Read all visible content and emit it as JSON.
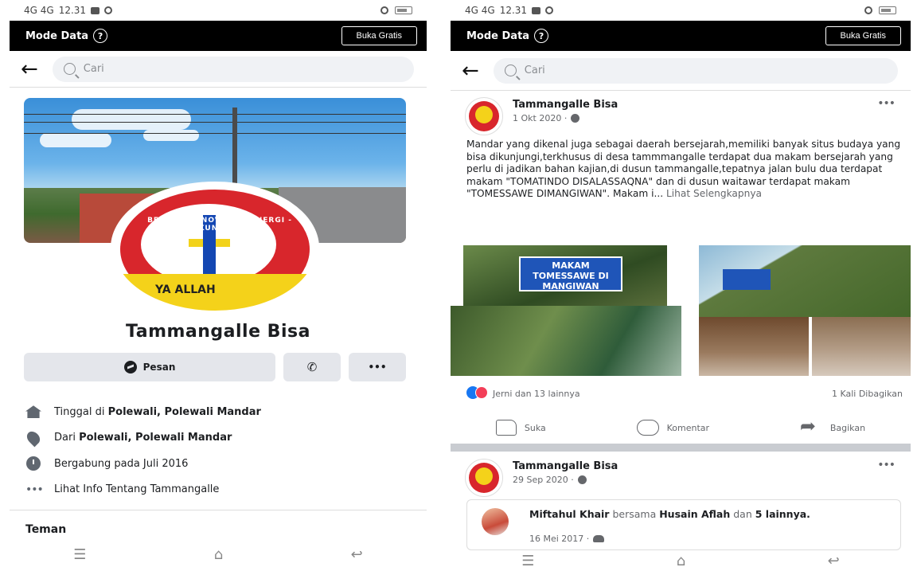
{
  "status": {
    "signal": "4G 4G",
    "time": "12.31"
  },
  "mode_bar": {
    "label": "Mode Data",
    "help_icon": "?",
    "free_button": "Buka Gratis"
  },
  "search": {
    "placeholder": "Cari"
  },
  "profile": {
    "name": "Tammangalle Bisa",
    "actions": {
      "message": "Pesan",
      "more": "•••"
    },
    "logo_ring_text": "BEKERJA - INOVASI - SINERGI - AKUNTABEL",
    "logo_banner_text": "YA ALLAH",
    "info": [
      {
        "prefix": "Tinggal di ",
        "bold": "Polewali, Polewali Mandar"
      },
      {
        "prefix": "Dari ",
        "bold": "Polewali, Polewali Mandar"
      },
      {
        "prefix": "Bergabung pada Juli 2016",
        "bold": ""
      },
      {
        "prefix": "Lihat Info Tentang Tammangalle",
        "bold": ""
      }
    ],
    "friends_heading": "Teman"
  },
  "post1": {
    "author": "Tammangalle Bisa",
    "date": "1 Okt 2020 ·",
    "text": "Mandar yang dikenal juga sebagai daerah bersejarah,memiliki banyak situs budaya yang bisa dikunjungi,terkhusus di desa tammmangalle terdapat dua makam bersejarah yang perlu di jadikan bahan kajian,di dusun tammangalle,tepatnya jalan bulu dua terdapat makam \"TOMATINDO DISALASSAQNA\" dan di dusun waitawar terdapat makam \"TOMESSAWE DIMANGIWAN\". Makam i...",
    "see_more": "Lihat Selengkapnya",
    "sign_text": "MAKAM TOMESSAWE DI MANGIWAN",
    "reactions": "Jerni dan 13 lainnya",
    "shares": "1 Kali Dibagikan",
    "like": "Suka",
    "comment": "Komentar",
    "share": "Bagikan"
  },
  "post2": {
    "author": "Tammangalle Bisa",
    "date": "29 Sep 2020 ·",
    "shared_author": "Miftahul Khair",
    "with_word": " bersama ",
    "tagged": "Husain Aflah",
    "and_word": " dan ",
    "others": "5 lainnya.",
    "shared_date": "16 Mei 2017 ·"
  },
  "nav": {
    "menu": "☰",
    "home": "⌂",
    "back": "↩"
  }
}
